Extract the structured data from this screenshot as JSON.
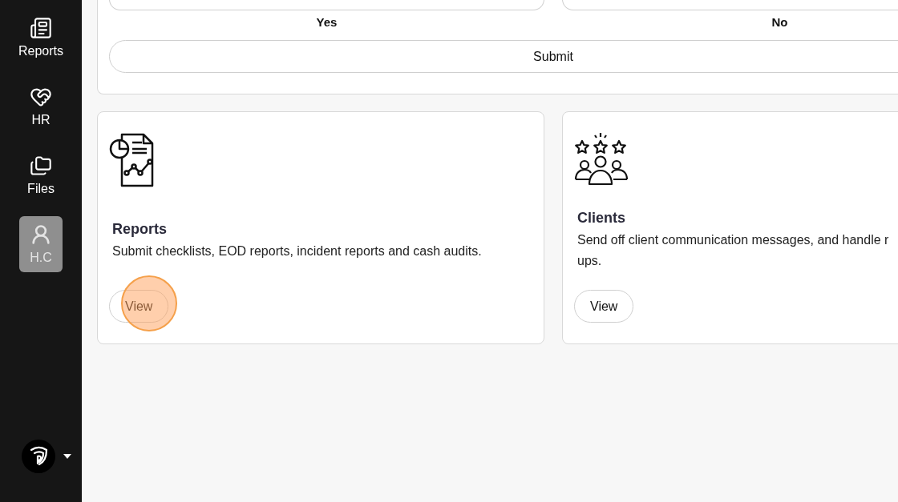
{
  "sidebar": {
    "items": [
      {
        "label": "Reports",
        "kind": "reports",
        "selected": false
      },
      {
        "label": "HR",
        "kind": "hr",
        "selected": false
      },
      {
        "label": "Files",
        "kind": "files",
        "selected": false
      },
      {
        "label": "H.C",
        "kind": "user",
        "selected": true
      }
    ]
  },
  "poll": {
    "options": [
      {
        "label": "Yes"
      },
      {
        "label": "No"
      }
    ],
    "submit": "Submit"
  },
  "cards": [
    {
      "kind": "reports",
      "title": "Reports",
      "description": [
        "Submit checklists, EOD reports, incident reports and cash audits."
      ],
      "button": "View",
      "clicked": true
    },
    {
      "kind": "clients",
      "title": "Clients",
      "description": [
        "Send off client communication messages, and handle r",
        "ups."
      ],
      "button": "View",
      "clicked": false
    }
  ]
}
